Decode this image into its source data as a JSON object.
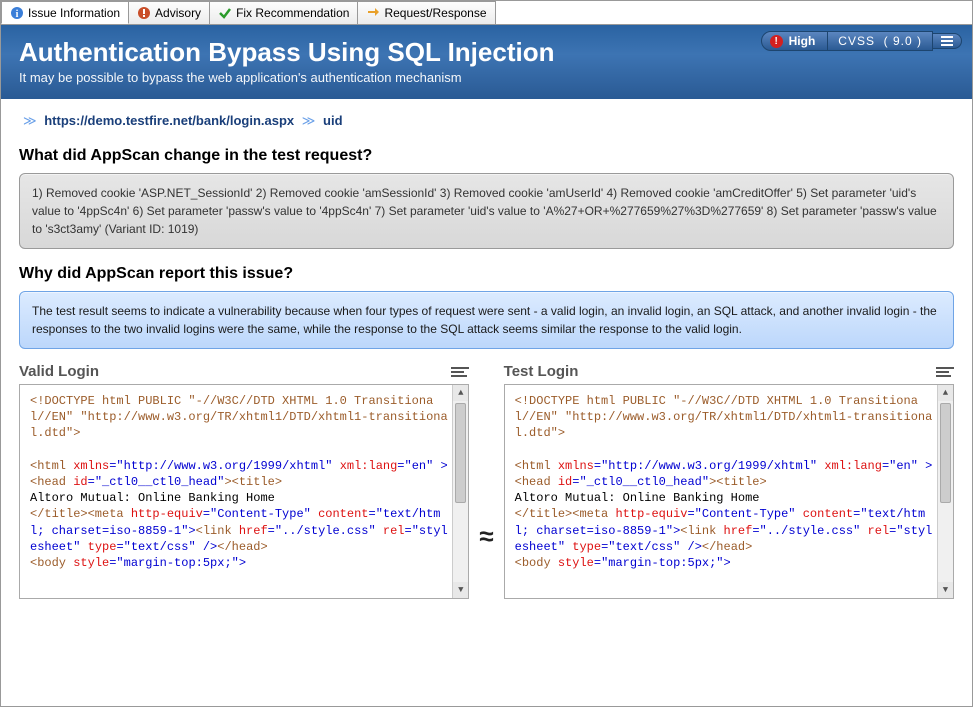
{
  "tabs": {
    "info": "Issue Information",
    "advisory": "Advisory",
    "fix": "Fix Recommendation",
    "reqresp": "Request/Response"
  },
  "badges": {
    "severity": "High",
    "cvss_label": "CVSS",
    "cvss_score": "( 9.0 )"
  },
  "header": {
    "title": "Authentication Bypass Using SQL Injection",
    "subtitle": "It may be possible to bypass the web application's authentication mechanism"
  },
  "breadcrumb": {
    "url": "https://demo.testfire.net/bank/login.aspx",
    "param": "uid"
  },
  "section1": {
    "heading": "What did AppScan change in the test request?",
    "body": "1) Removed cookie 'ASP.NET_SessionId' 2) Removed cookie 'amSessionId' 3) Removed cookie 'amUserId' 4) Removed cookie 'amCreditOffer' 5) Set parameter 'uid's value to '4ppSc4n' 6) Set parameter 'passw's value to '4ppSc4n' 7) Set parameter 'uid's value to 'A%27+OR+%277659%27%3D%277659' 8) Set parameter 'passw's value to 's3ct3amy' (Variant ID: 1019)"
  },
  "section2": {
    "heading": "Why did AppScan report this issue?",
    "body": "The test result seems to indicate a vulnerability because when four types of request were sent - a valid login, an invalid login, an SQL attack, and another invalid login - the responses to the two invalid logins were the same, while the response to the SQL attack seems similar the response to the valid login."
  },
  "compare": {
    "left_title": "Valid Login",
    "right_title": "Test Login",
    "approx": "≈"
  },
  "code": {
    "l1": "<!DOCTYPE html PUBLIC \"-//W3C//DTD XHTML 1.0 Transitional//EN\" \"http://www.w3.org/TR/xhtml1/DTD/xhtml1-transitional.dtd\">",
    "html_open": "<html ",
    "xmlns_attr": "xmlns",
    "xmlns_val": "=\"http://www.w3.org/1999/xhtml\"",
    "xmllang_attr": "xml:lang",
    "xmllang_val": "=\"en\" >",
    "head_open": "<head ",
    "id_attr": "id",
    "id_val": "=\"_ctl0__ctl0_head\"",
    "title_open": "><title>",
    "title_text": "Altoro Mutual: Online Banking Home",
    "title_close": "</title>",
    "meta_open": "<meta ",
    "httpeq_attr": "http-equiv",
    "httpeq_val": "=\"Content-Type\"",
    "content_attr": "content",
    "content_val": "=\"text/html; charset=iso-8859-1\">",
    "link_open": "<link ",
    "href_attr": "href",
    "href_val": "=\"../style.css\"",
    "rel_attr": "rel",
    "rel_val": "=\"stylesheet\"",
    "type_attr": "type",
    "type_val": "=\"text/css\" />",
    "head_close": "</head>",
    "body_open": "<body ",
    "style_attr": "style",
    "style_val": "=\"margin-top:5px;\">"
  }
}
